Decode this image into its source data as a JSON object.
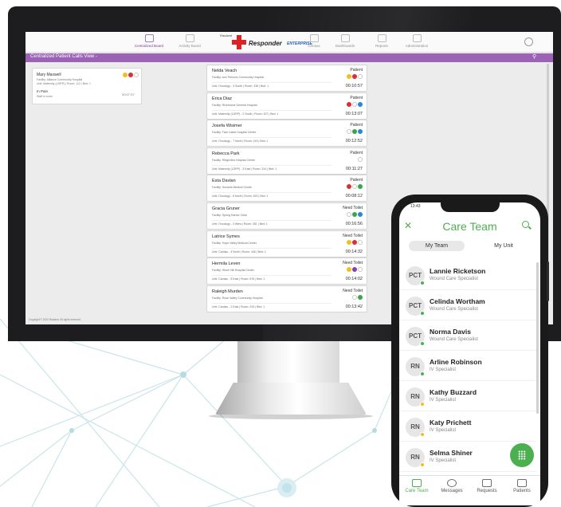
{
  "colors": {
    "accent_purple": "#9b62b5",
    "phone_green": "#4caf50",
    "brand_red": "#d92325",
    "bezel": "#1d1d1f"
  },
  "desktop": {
    "nav": {
      "items": [
        {
          "label": "Centralized Board",
          "icon": "snowflake-icon",
          "active": true
        },
        {
          "label": "Activity Board",
          "icon": "board-icon",
          "active": false
        },
        {
          "label": "Census",
          "icon": "census-icon",
          "active": false
        },
        {
          "label": "Dashboards",
          "icon": "dashboard-icon",
          "active": false
        },
        {
          "label": "Reports",
          "icon": "reports-icon",
          "active": false
        },
        {
          "label": "Administration",
          "icon": "admin-gear-icon",
          "active": false
        }
      ],
      "logo_top": "Rauland",
      "logo_main": "Responder",
      "logo_sub": "ENTERPRISE"
    },
    "title": "Centralized Patient Calls View -",
    "left_card": {
      "name": "Mary Maxwell",
      "facility": "Facility: Alliance Community Hospital",
      "unit": "Unit: Maternity (LDRP) | Room: 112 | Bed: 1",
      "call": "In Pain",
      "note": "Staff in room",
      "time": "00:07:37"
    },
    "cards": [
      {
        "name": "Nelda Veach",
        "facility": "Facility: Ann Persons Community Hospital",
        "unit": "Unit: Oncology - 3 South | Room: 336 | Bed: 1",
        "status": "Patient",
        "time": "00:10:57",
        "dots": [
          "y",
          "r",
          "n"
        ]
      },
      {
        "name": "Erica Diaz",
        "facility": "Facility: Riverstone General Hospital",
        "unit": "Unit: Maternity (LDRP) - 2 South | Room: 307 | Bed: 1",
        "status": "Patient",
        "time": "00:13:07",
        "dots": [
          "r",
          "n",
          "b"
        ]
      },
      {
        "name": "Josefa Wisimer",
        "facility": "Facility: Twin Lakes Hospital Centre",
        "unit": "Unit: Oncology - 7 North | Room: 243 | Bed: 1",
        "status": "Patient",
        "time": "00:12:52",
        "dots": [
          "n",
          "g",
          "b"
        ]
      },
      {
        "name": "Rebecca Park",
        "facility": "Facility: Ridgeview Hospital Center",
        "unit": "Unit: Maternity (LDRP) - 3 East | Room: 314 | Bed: 1",
        "status": "Patient",
        "time": "00:11:27",
        "dots": [
          "n"
        ]
      },
      {
        "name": "Esta Davlan",
        "facility": "Facility: Sunsets Medical Centre",
        "unit": "Unit: Oncology - 6 North | Room: 520 | Bed: 1",
        "status": "Patient",
        "time": "00:08:12",
        "dots": [
          "r",
          "n",
          "g"
        ]
      },
      {
        "name": "Gracia Gruner",
        "facility": "Facility: Spring Harbor Clinic",
        "unit": "Unit: Oncology - 3 West | Room: 351 | Bed: 1",
        "status": "Need Toilet",
        "time": "00:16:56",
        "dots": [
          "n",
          "g",
          "b"
        ]
      },
      {
        "name": "Latrice Symes",
        "facility": "Facility: Hope Valley Medical Center",
        "unit": "Unit: Cardiac - 4 North | Room: 446 | Bed: 1",
        "status": "Need Toilet",
        "time": "00:14:32",
        "dots": [
          "y",
          "r",
          "n"
        ]
      },
      {
        "name": "Hermila Leven",
        "facility": "Facility: Stone Hill Hospital Center",
        "unit": "Unit: Cardiac - 5 East | Room: 576 | Bed: 1",
        "status": "Need Toilet",
        "time": "00:14:02",
        "dots": [
          "y",
          "p",
          "n"
        ]
      },
      {
        "name": "Raleigh Murden",
        "facility": "Facility: Rose Valley Community Hospital",
        "unit": "Unit: Cardiac - 2 East | Room: 243 | Bed: 1",
        "status": "Need Toilet",
        "time": "00:13:42",
        "dots": [
          "n",
          "g"
        ]
      }
    ],
    "copyright": "Copyright © 2020 Rauland. All rights reserved."
  },
  "phone": {
    "clock": "13:43",
    "title": "Care Team",
    "tabs": [
      {
        "label": "My Team",
        "active": true
      },
      {
        "label": "My Unit",
        "active": false
      }
    ],
    "members": [
      {
        "initials": "PCT",
        "name": "Lannie Ricketson",
        "role": "Wound Care Specialist",
        "presence": "g"
      },
      {
        "initials": "PCT",
        "name": "Celinda Wortham",
        "role": "Wound Care Specialist",
        "presence": "g"
      },
      {
        "initials": "PCT",
        "name": "Norma Davis",
        "role": "Wound Care Specialist",
        "presence": "g"
      },
      {
        "initials": "RN",
        "name": "Arline Robinson",
        "role": "IV Specialist",
        "presence": "g"
      },
      {
        "initials": "RN",
        "name": "Kathy Buzzard",
        "role": "IV Specialist",
        "presence": "y"
      },
      {
        "initials": "RN",
        "name": "Katy Prichett",
        "role": "IV Specialist",
        "presence": "y"
      },
      {
        "initials": "RN",
        "name": "Selma Shiner",
        "role": "IV Specialist",
        "presence": "y"
      }
    ],
    "bottom_nav": [
      {
        "label": "Care Team",
        "icon": "care-team-icon",
        "active": true
      },
      {
        "label": "Messages",
        "icon": "messages-icon",
        "active": false
      },
      {
        "label": "Requests",
        "icon": "requests-icon",
        "active": false
      },
      {
        "label": "Patients",
        "icon": "patients-bed-icon",
        "active": false
      }
    ]
  }
}
